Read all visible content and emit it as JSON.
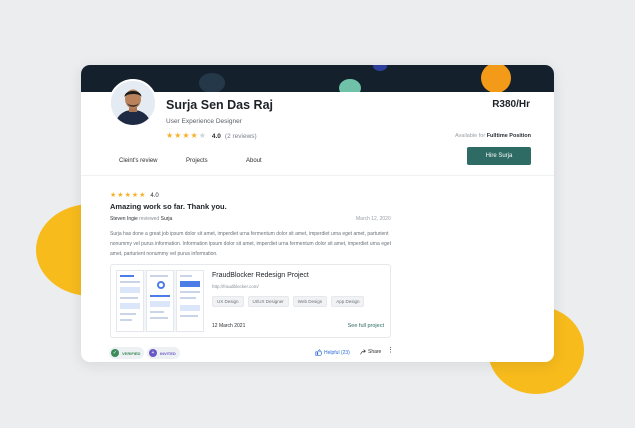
{
  "colors": {
    "accent": "#2d6b64",
    "banner": "#14212d",
    "star": "#f4b12a",
    "blob": "#f7bb1c"
  },
  "profile": {
    "name": "Surja Sen Das Raj",
    "role": "User Experience Designer",
    "rating": "4.0",
    "reviews": "(2 reviews)",
    "stars_filled": 4,
    "stars_total": 5,
    "rate": "R380/Hr",
    "availability_prefix": "Available for",
    "availability_type": "Fulltime Position",
    "hire_label": "Hire Surja"
  },
  "tabs": [
    {
      "label": "Cleint's review"
    },
    {
      "label": "Projects"
    },
    {
      "label": "About"
    }
  ],
  "review": {
    "stars": 5,
    "rating": "4.0",
    "title": "Amazing work so far. Thank you.",
    "reviewer": "Steven Ingie",
    "action": "reviewed",
    "target": "Surja",
    "date": "March 12, 2020",
    "body": "Surja has done a great job  ipsum dolor sit amet, imperdiet urna fermentum dolor sit amet, imperdiet urna eget amet, parturient nonummy vel purus information. Information ipsum dolor sit amet, imperdiet urna fermentum dolor sit amet, imperdiet urna eget amet, parturient nonummy vel purus information."
  },
  "project": {
    "title": "FraudBlocker Redesign Project",
    "url": "http://fraudblocker.com/",
    "tags": [
      "UX Design",
      "UI/UX Designer",
      "Web Design",
      "App Design"
    ],
    "date": "12 March 2021",
    "link": "See full project"
  },
  "footer": {
    "verified": "VERIFIED",
    "invited": "INVITED",
    "helpful": "Helpful (23)",
    "share": "Share"
  }
}
